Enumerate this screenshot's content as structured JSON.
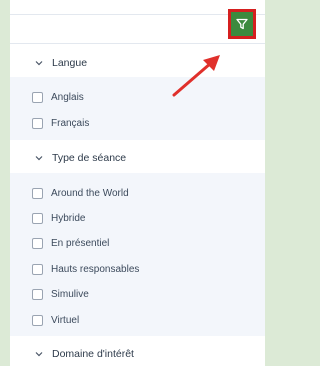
{
  "sections": [
    {
      "label": "Langue",
      "options": [
        "Anglais",
        "Français"
      ]
    },
    {
      "label": "Type de séance",
      "options": [
        "Around the World",
        "Hybride",
        "En présentiel",
        "Hauts responsables",
        "Simulive",
        "Virtuel"
      ]
    },
    {
      "label": "Domaine d'intérêt",
      "options": []
    }
  ],
  "colors": {
    "highlight": "#d51f1f",
    "filter_button": "#3c8a3e",
    "section_body": "#f3f6fb"
  },
  "icons": {
    "filter": "filter-icon",
    "chevron": "chevron-down-icon",
    "annotation": "red-arrow"
  }
}
